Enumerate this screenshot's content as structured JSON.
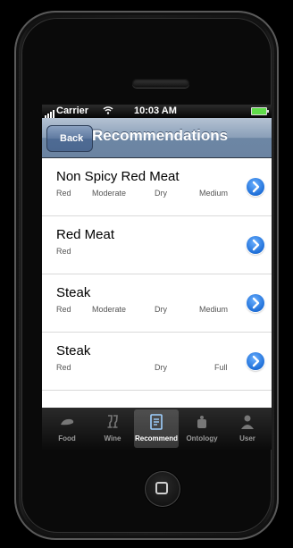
{
  "status": {
    "carrier": "Carrier",
    "time": "10:03 AM"
  },
  "nav": {
    "back_label": "Back",
    "title": "Recommendations"
  },
  "items": [
    {
      "title": "Non Spicy Red Meat",
      "col1": "Red",
      "col2": "Moderate",
      "col3": "Dry",
      "col4": "Medium"
    },
    {
      "title": "Red Meat",
      "col1": "Red",
      "col2": "",
      "col3": "",
      "col4": ""
    },
    {
      "title": "Steak",
      "col1": "Red",
      "col2": "Moderate",
      "col3": "Dry",
      "col4": "Medium"
    },
    {
      "title": "Steak",
      "col1": "Red",
      "col2": "",
      "col3": "Dry",
      "col4": "Full"
    }
  ],
  "tabs": [
    {
      "label": "Food",
      "icon": "food-icon"
    },
    {
      "label": "Wine",
      "icon": "wine-icon"
    },
    {
      "label": "Recommend",
      "icon": "recommend-icon"
    },
    {
      "label": "Ontology",
      "icon": "ontology-icon"
    },
    {
      "label": "User",
      "icon": "user-icon"
    }
  ],
  "active_tab": "Recommend",
  "colors": {
    "nav_bar": "#6d86a4",
    "disclosure": "#1f6fd8",
    "tab_bar": "#111111"
  }
}
